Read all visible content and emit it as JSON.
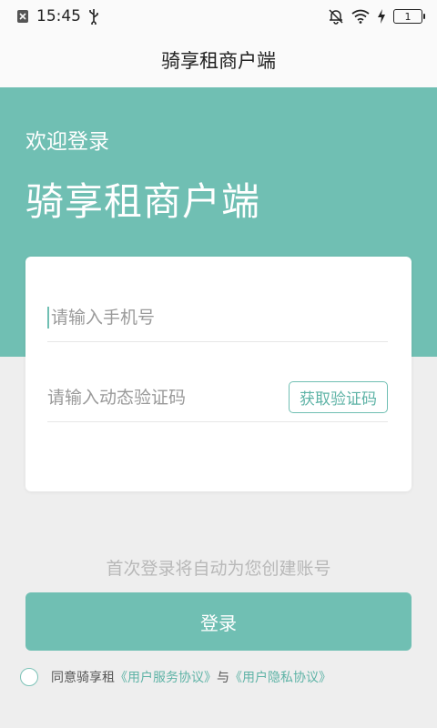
{
  "status_bar": {
    "time": "15:45",
    "battery_level": "1",
    "icons": [
      "close-box-icon",
      "usb-icon",
      "bell-off-icon",
      "wifi-icon",
      "charging-bolt-icon",
      "battery-icon"
    ]
  },
  "header": {
    "title": "骑享租商户端"
  },
  "hero": {
    "welcome": "欢迎登录",
    "app_name": "骑享租商户端"
  },
  "form": {
    "phone_placeholder": "请输入手机号",
    "code_placeholder": "请输入动态验证码",
    "get_code_label": "获取验证码"
  },
  "hint": "首次登录将自动为您创建账号",
  "login_label": "登录",
  "agreement": {
    "prefix": "同意骑享租",
    "service_link": "《用户服务协议》",
    "joiner": "与",
    "privacy_link": "《用户隐私协议》",
    "checked": false
  },
  "colors": {
    "accent": "#70bfb3",
    "link": "#5eb3a6",
    "background": "#eeeeee"
  }
}
